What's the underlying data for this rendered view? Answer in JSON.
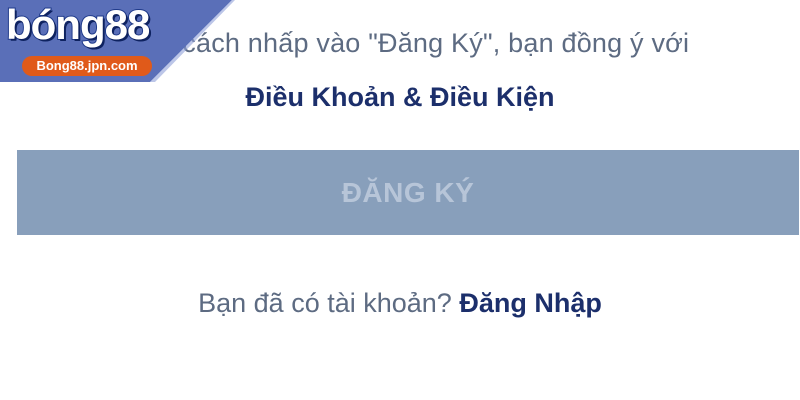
{
  "form": {
    "agree_text": "Bằng cách nhấp vào \"Đăng Ký\", bạn đồng ý với",
    "terms_link": "Điều Khoản & Điều Kiện",
    "register_button": "ĐĂNG KÝ",
    "have_account_text": "Bạn đã có tài khoản?",
    "login_link": "Đăng Nhập"
  },
  "watermark": {
    "brand": "bóng88",
    "domain": "Bong88.jpn.com"
  },
  "colors": {
    "text_muted": "#5d6b82",
    "link": "#1c2f6b",
    "button_bg": "#889fbb",
    "button_text": "#b7c5d8",
    "logo_panel": "#5a6fb8",
    "logo_badge": "#e05a1a"
  }
}
